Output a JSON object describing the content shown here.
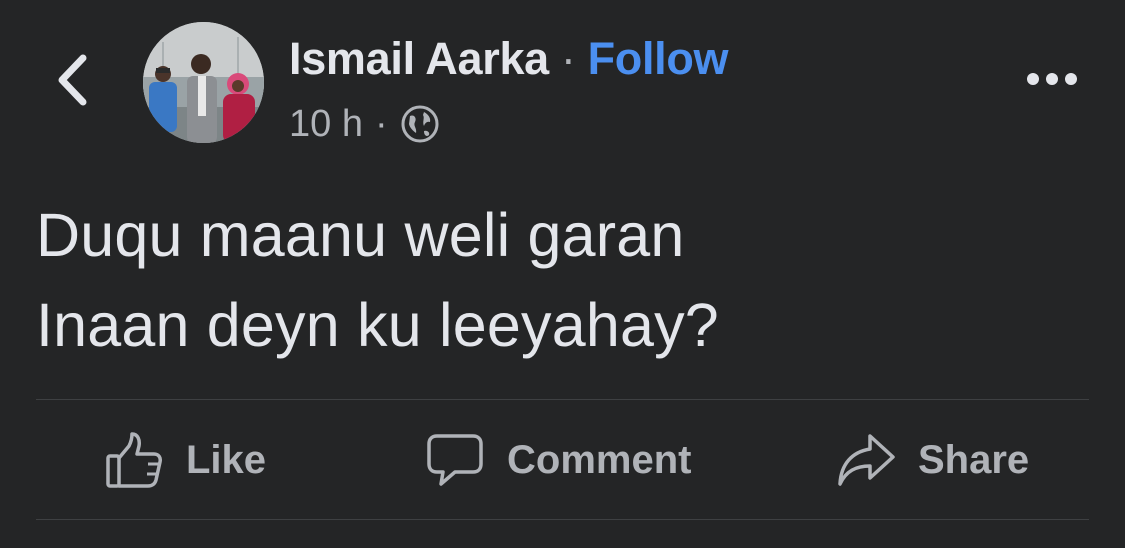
{
  "header": {
    "author_name": "Ismail Aarka",
    "separator": "·",
    "follow_label": "Follow",
    "time": "10 h",
    "meta_separator": "·",
    "privacy_icon": "globe-icon",
    "back_icon": "chevron-left-icon",
    "more_icon": "more-horizontal-icon"
  },
  "post": {
    "lines": [
      "Duqu maanu weli garan",
      "Inaan deyn ku leeyahay?"
    ]
  },
  "actions": [
    {
      "label": "Like",
      "icon": "thumbs-up-icon"
    },
    {
      "label": "Comment",
      "icon": "speech-bubble-icon"
    },
    {
      "label": "Share",
      "icon": "share-arrow-icon"
    }
  ],
  "colors": {
    "background": "#242526",
    "primary_text": "#e4e6eb",
    "secondary_text": "#b0b3b8",
    "link": "#4b8ff0",
    "divider": "#3e4042"
  }
}
